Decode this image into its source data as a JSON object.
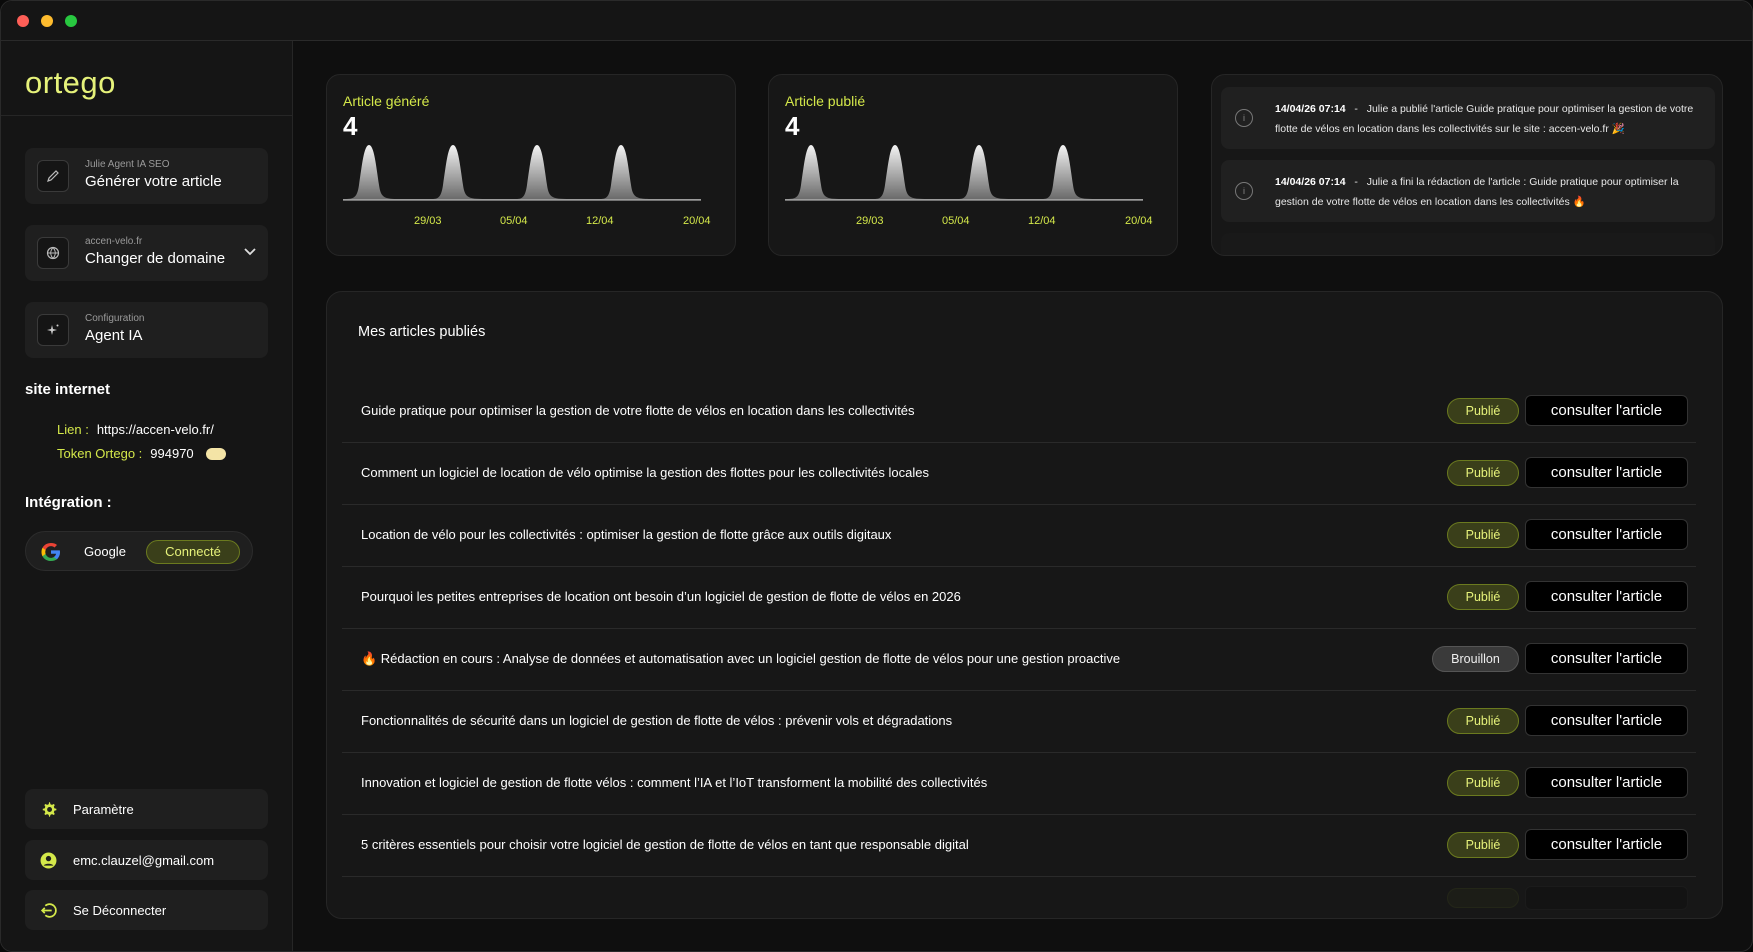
{
  "app": {
    "logo_text": "ortego",
    "accent_color": "#d4e84a"
  },
  "sidebar": {
    "cards": [
      {
        "sub": "Julie Agent IA SEO",
        "main": "Générer votre article",
        "icon": "pen-icon"
      },
      {
        "sub": "accen-velo.fr",
        "main": "Changer de domaine",
        "icon": "globe-icon"
      },
      {
        "sub": "Configuration",
        "main": "Agent IA",
        "icon": "sparkle-icon"
      }
    ],
    "site_title": "site internet",
    "site": {
      "link_label": "Lien :",
      "link_value": "https://accen-velo.fr/",
      "token_label": "Token Ortego :",
      "token_value": "994970"
    },
    "integration_title": "Intégration :",
    "integration": {
      "provider": "Google",
      "status": "Connecté"
    },
    "bottom": [
      {
        "label": "Paramètre",
        "icon": "gear-icon"
      },
      {
        "label": "emc.clauzel@gmail.com",
        "icon": "user-icon"
      },
      {
        "label": "Se Déconnecter",
        "icon": "logout-icon"
      }
    ]
  },
  "stats": [
    {
      "title": "Article généré",
      "value": "4",
      "ticks": [
        "29/03",
        "05/04",
        "12/04",
        "20/04"
      ]
    },
    {
      "title": "Article publié",
      "value": "4",
      "ticks": [
        "29/03",
        "05/04",
        "12/04",
        "20/04"
      ]
    }
  ],
  "activity": [
    {
      "time": "14/04/26 07:14",
      "sep": "-",
      "text": "Julie a publié l'article Guide pratique pour optimiser la gestion de votre flotte de vélos en location dans les collectivités sur le site : accen-velo.fr 🎉"
    },
    {
      "time": "14/04/26 07:14",
      "sep": "-",
      "text": "Julie a fini la rédaction de l'article : Guide pratique pour optimiser la gestion de votre flotte de vélos en location dans les collectivités 🔥"
    }
  ],
  "articles": {
    "title": "Mes articles publiés",
    "consult_label": "consulter l'article",
    "rows": [
      {
        "title": "Guide pratique pour optimiser la gestion de votre flotte de vélos en location dans les collectivités",
        "status": "Publié"
      },
      {
        "title": "Comment un logiciel de location de vélo optimise la gestion des flottes pour les collectivités locales",
        "status": "Publié"
      },
      {
        "title": "Location de vélo pour les collectivités : optimiser la gestion de flotte grâce aux outils digitaux",
        "status": "Publié"
      },
      {
        "title": "Pourquoi les petites entreprises de location ont besoin d’un logiciel de gestion de flotte de vélos en 2026",
        "status": "Publié"
      },
      {
        "title": "🔥 Rédaction en cours : Analyse de données et automatisation avec un logiciel gestion de flotte de vélos pour une gestion proactive",
        "status": "Brouillon"
      },
      {
        "title": "Fonctionnalités de sécurité dans un logiciel de gestion de flotte de vélos : prévenir vols et dégradations",
        "status": "Publié"
      },
      {
        "title": "Innovation et logiciel de gestion de flotte vélos : comment l’IA et l’IoT transforment la mobilité des collectivités",
        "status": "Publié"
      },
      {
        "title": "5 critères essentiels pour choisir votre logiciel de gestion de flotte de vélos en tant que responsable digital",
        "status": "Publié"
      }
    ]
  }
}
